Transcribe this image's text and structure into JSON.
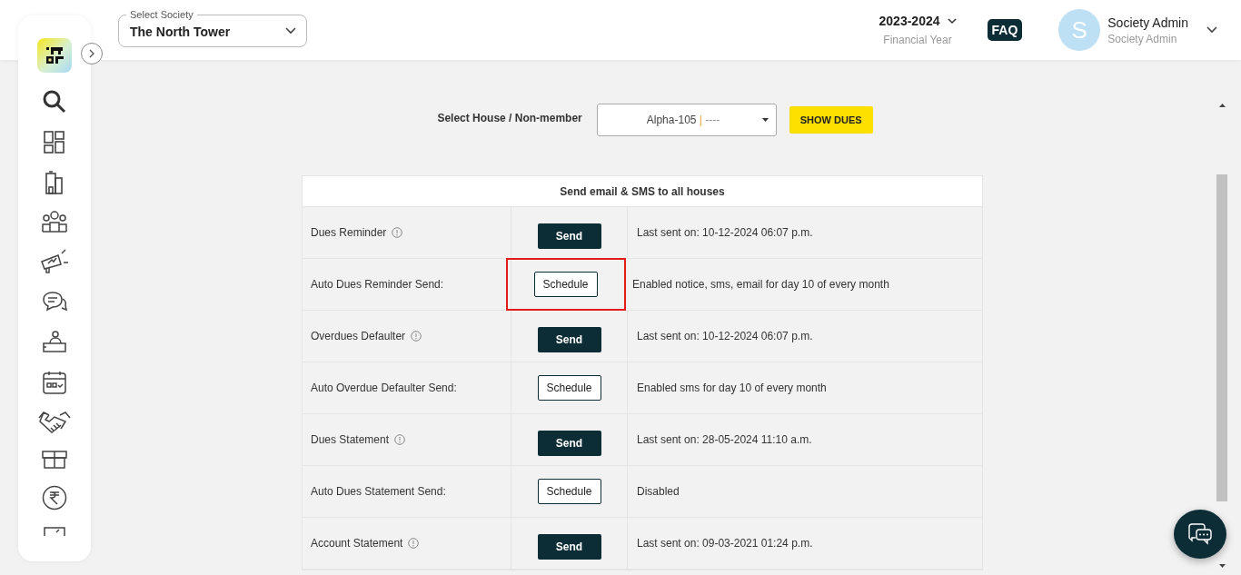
{
  "header": {
    "society_select": {
      "label": "Select Society",
      "value": "The North Tower"
    },
    "financial_year": {
      "value": "2023-2024",
      "label": "Financial Year"
    },
    "faq": "FAQ",
    "user": {
      "initial": "S",
      "name": "Society Admin",
      "role": "Society Admin"
    }
  },
  "filter": {
    "label": "Select House / Non-member",
    "house": "Alpha-105",
    "separator": "|",
    "member": "----",
    "button": "SHOW DUES"
  },
  "table": {
    "title": "Send email & SMS to all houses",
    "rows": [
      {
        "label": "Dues Reminder",
        "kind": "send",
        "button": "Send",
        "status": "Last sent on: 10-12-2024 06:07 p.m.",
        "highlighted": false
      },
      {
        "label": "Auto Dues Reminder Send:",
        "kind": "schedule",
        "button": "Schedule",
        "status": "Enabled notice, sms, email for day 10 of every month",
        "highlighted": true
      },
      {
        "label": "Overdues Defaulter",
        "kind": "send",
        "button": "Send",
        "status": "Last sent on: 10-12-2024 06:07 p.m.",
        "highlighted": false
      },
      {
        "label": "Auto Overdue Defaulter Send:",
        "kind": "schedule",
        "button": "Schedule",
        "status": "Enabled sms for day 10 of every month",
        "highlighted": false
      },
      {
        "label": "Dues Statement",
        "kind": "send",
        "button": "Send",
        "status": "Last sent on: 28-05-2024 11:10 a.m.",
        "highlighted": false
      },
      {
        "label": "Auto Dues Statement Send:",
        "kind": "schedule",
        "button": "Schedule",
        "status": "Disabled",
        "highlighted": false
      },
      {
        "label": "Account Statement",
        "kind": "send",
        "button": "Send",
        "status": "Last sent on: 09-03-2021 01:24 p.m.",
        "highlighted": false
      }
    ]
  }
}
